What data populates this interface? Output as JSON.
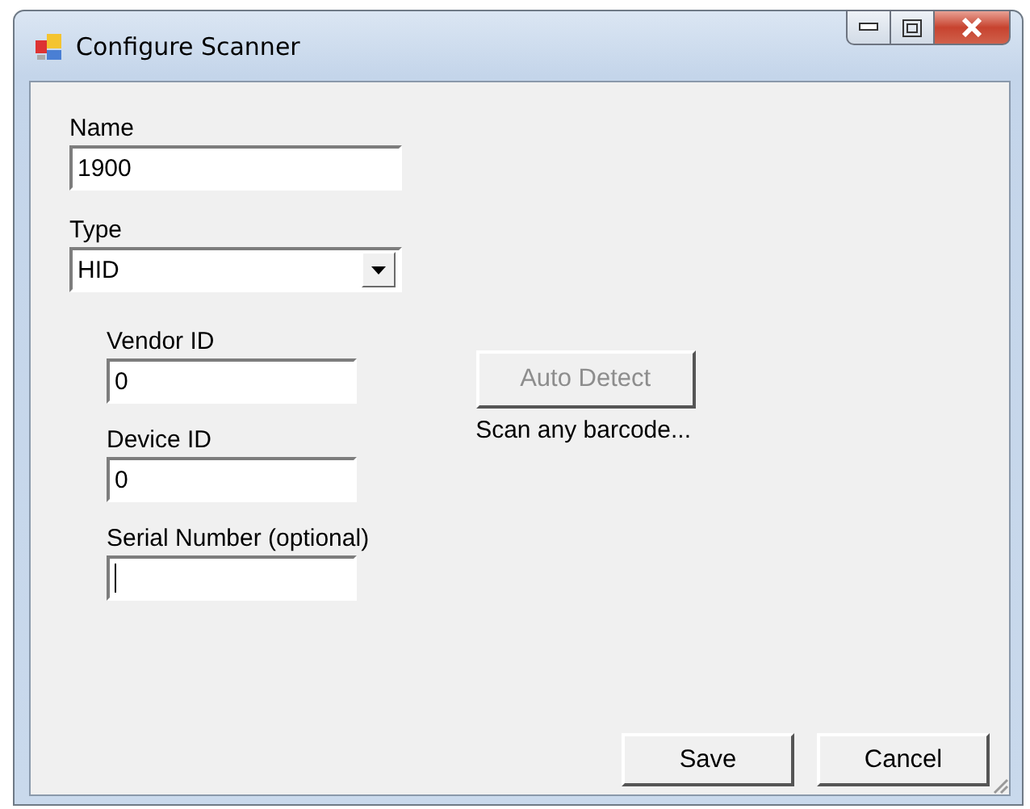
{
  "window": {
    "title": "Configure Scanner"
  },
  "name": {
    "label": "Name",
    "value": "1900"
  },
  "type": {
    "label": "Type",
    "value": "HID"
  },
  "id_fields": [
    {
      "label": "Vendor ID",
      "value": "0",
      "focused": false
    },
    {
      "label": "Device ID",
      "value": "0",
      "focused": false
    },
    {
      "label": "Serial Number (optional)",
      "focused": true
    }
  ],
  "auto_detect": {
    "label": "Auto Detect",
    "disabled": true
  },
  "scan_hint": "Scan any barcode...",
  "buttons": [
    "Save",
    "Cancel"
  ]
}
